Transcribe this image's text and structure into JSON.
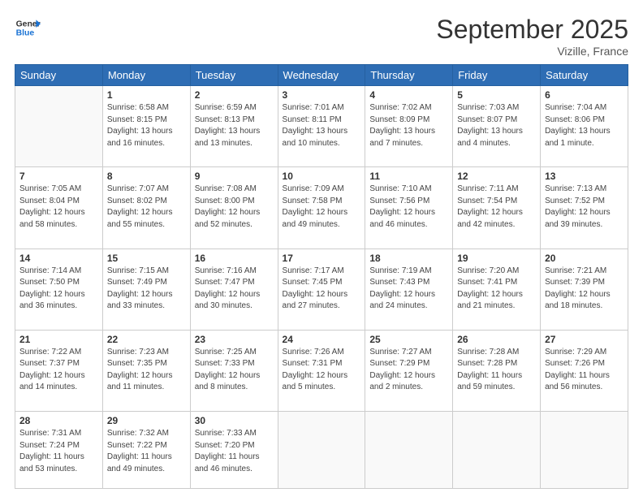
{
  "header": {
    "logo_line1": "General",
    "logo_line2": "Blue",
    "month": "September 2025",
    "location": "Vizille, France"
  },
  "days_of_week": [
    "Sunday",
    "Monday",
    "Tuesday",
    "Wednesday",
    "Thursday",
    "Friday",
    "Saturday"
  ],
  "weeks": [
    [
      {
        "day": "",
        "info": ""
      },
      {
        "day": "1",
        "info": "Sunrise: 6:58 AM\nSunset: 8:15 PM\nDaylight: 13 hours\nand 16 minutes."
      },
      {
        "day": "2",
        "info": "Sunrise: 6:59 AM\nSunset: 8:13 PM\nDaylight: 13 hours\nand 13 minutes."
      },
      {
        "day": "3",
        "info": "Sunrise: 7:01 AM\nSunset: 8:11 PM\nDaylight: 13 hours\nand 10 minutes."
      },
      {
        "day": "4",
        "info": "Sunrise: 7:02 AM\nSunset: 8:09 PM\nDaylight: 13 hours\nand 7 minutes."
      },
      {
        "day": "5",
        "info": "Sunrise: 7:03 AM\nSunset: 8:07 PM\nDaylight: 13 hours\nand 4 minutes."
      },
      {
        "day": "6",
        "info": "Sunrise: 7:04 AM\nSunset: 8:06 PM\nDaylight: 13 hours\nand 1 minute."
      }
    ],
    [
      {
        "day": "7",
        "info": "Sunrise: 7:05 AM\nSunset: 8:04 PM\nDaylight: 12 hours\nand 58 minutes."
      },
      {
        "day": "8",
        "info": "Sunrise: 7:07 AM\nSunset: 8:02 PM\nDaylight: 12 hours\nand 55 minutes."
      },
      {
        "day": "9",
        "info": "Sunrise: 7:08 AM\nSunset: 8:00 PM\nDaylight: 12 hours\nand 52 minutes."
      },
      {
        "day": "10",
        "info": "Sunrise: 7:09 AM\nSunset: 7:58 PM\nDaylight: 12 hours\nand 49 minutes."
      },
      {
        "day": "11",
        "info": "Sunrise: 7:10 AM\nSunset: 7:56 PM\nDaylight: 12 hours\nand 46 minutes."
      },
      {
        "day": "12",
        "info": "Sunrise: 7:11 AM\nSunset: 7:54 PM\nDaylight: 12 hours\nand 42 minutes."
      },
      {
        "day": "13",
        "info": "Sunrise: 7:13 AM\nSunset: 7:52 PM\nDaylight: 12 hours\nand 39 minutes."
      }
    ],
    [
      {
        "day": "14",
        "info": "Sunrise: 7:14 AM\nSunset: 7:50 PM\nDaylight: 12 hours\nand 36 minutes."
      },
      {
        "day": "15",
        "info": "Sunrise: 7:15 AM\nSunset: 7:49 PM\nDaylight: 12 hours\nand 33 minutes."
      },
      {
        "day": "16",
        "info": "Sunrise: 7:16 AM\nSunset: 7:47 PM\nDaylight: 12 hours\nand 30 minutes."
      },
      {
        "day": "17",
        "info": "Sunrise: 7:17 AM\nSunset: 7:45 PM\nDaylight: 12 hours\nand 27 minutes."
      },
      {
        "day": "18",
        "info": "Sunrise: 7:19 AM\nSunset: 7:43 PM\nDaylight: 12 hours\nand 24 minutes."
      },
      {
        "day": "19",
        "info": "Sunrise: 7:20 AM\nSunset: 7:41 PM\nDaylight: 12 hours\nand 21 minutes."
      },
      {
        "day": "20",
        "info": "Sunrise: 7:21 AM\nSunset: 7:39 PM\nDaylight: 12 hours\nand 18 minutes."
      }
    ],
    [
      {
        "day": "21",
        "info": "Sunrise: 7:22 AM\nSunset: 7:37 PM\nDaylight: 12 hours\nand 14 minutes."
      },
      {
        "day": "22",
        "info": "Sunrise: 7:23 AM\nSunset: 7:35 PM\nDaylight: 12 hours\nand 11 minutes."
      },
      {
        "day": "23",
        "info": "Sunrise: 7:25 AM\nSunset: 7:33 PM\nDaylight: 12 hours\nand 8 minutes."
      },
      {
        "day": "24",
        "info": "Sunrise: 7:26 AM\nSunset: 7:31 PM\nDaylight: 12 hours\nand 5 minutes."
      },
      {
        "day": "25",
        "info": "Sunrise: 7:27 AM\nSunset: 7:29 PM\nDaylight: 12 hours\nand 2 minutes."
      },
      {
        "day": "26",
        "info": "Sunrise: 7:28 AM\nSunset: 7:28 PM\nDaylight: 11 hours\nand 59 minutes."
      },
      {
        "day": "27",
        "info": "Sunrise: 7:29 AM\nSunset: 7:26 PM\nDaylight: 11 hours\nand 56 minutes."
      }
    ],
    [
      {
        "day": "28",
        "info": "Sunrise: 7:31 AM\nSunset: 7:24 PM\nDaylight: 11 hours\nand 53 minutes."
      },
      {
        "day": "29",
        "info": "Sunrise: 7:32 AM\nSunset: 7:22 PM\nDaylight: 11 hours\nand 49 minutes."
      },
      {
        "day": "30",
        "info": "Sunrise: 7:33 AM\nSunset: 7:20 PM\nDaylight: 11 hours\nand 46 minutes."
      },
      {
        "day": "",
        "info": ""
      },
      {
        "day": "",
        "info": ""
      },
      {
        "day": "",
        "info": ""
      },
      {
        "day": "",
        "info": ""
      }
    ]
  ]
}
